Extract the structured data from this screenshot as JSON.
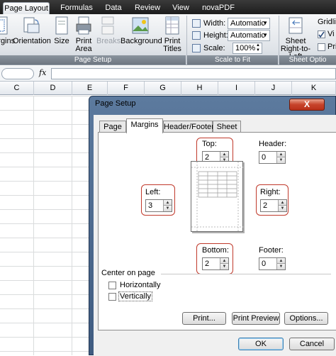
{
  "ribbon": {
    "tabs": [
      {
        "label": "Page Layout",
        "active": true
      },
      {
        "label": "Formulas"
      },
      {
        "label": "Data"
      },
      {
        "label": "Review"
      },
      {
        "label": "View"
      },
      {
        "label": "novaPDF"
      }
    ],
    "page_setup": {
      "margins": "Margins",
      "orientation": "Orientation",
      "size": "Size",
      "print_area_1": "Print",
      "print_area_2": "Area",
      "breaks": "Breaks",
      "background": "Background",
      "print_titles_1": "Print",
      "print_titles_2": "Titles",
      "group_label": "Page Setup"
    },
    "scale_to_fit": {
      "width_label": "Width:",
      "width_value": "Automatic",
      "height_label": "Height:",
      "height_value": "Automatic",
      "scale_label": "Scale:",
      "scale_value": "100%",
      "group_label": "Scale to Fit"
    },
    "sheet_options": {
      "sheet_rtl_1": "Sheet",
      "sheet_rtl_2": "Right-to-Left",
      "gridlines": "Gridlin",
      "view": "Vi",
      "print": "Pri",
      "group_label": "Sheet Optio"
    }
  },
  "formula_bar": {
    "fx": "fx"
  },
  "columns": [
    "C",
    "D",
    "E",
    "F",
    "G",
    "H",
    "I",
    "J",
    "K"
  ],
  "dialog": {
    "title": "Page Setup",
    "close": "X",
    "tabs": [
      "Page",
      "Margins",
      "Header/Footer",
      "Sheet"
    ],
    "top_label": "Top:",
    "top_value": "2",
    "header_label": "Header:",
    "header_value": "0",
    "left_label": "Left:",
    "left_value": "3",
    "right_label": "Right:",
    "right_value": "2",
    "bottom_label": "Bottom:",
    "bottom_value": "2",
    "footer_label": "Footer:",
    "footer_value": "0",
    "center_on_page": "Center on page",
    "horizontally": "Horizontally",
    "vertically": "Vertically",
    "print_btn": "Print...",
    "print_preview_btn": "Print Preview",
    "options_btn": "Options...",
    "ok_btn": "OK",
    "cancel_btn": "Cancel"
  }
}
